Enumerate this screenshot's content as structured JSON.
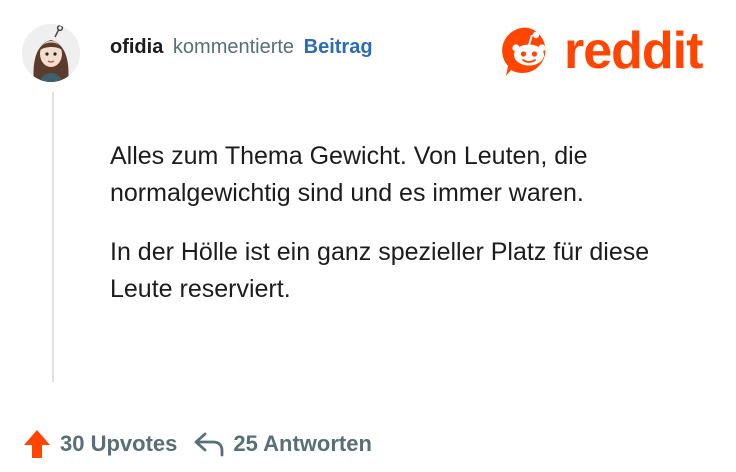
{
  "comment": {
    "username": "ofidia",
    "action": "kommentierte",
    "post_link": "Beitrag",
    "paragraphs": [
      "Alles zum Thema Gewicht. Von Leuten, die normalgewichtig sind und es immer waren.",
      "In der Hölle ist ein ganz spezieller Platz für diese Leute reserviert."
    ]
  },
  "brand": {
    "wordmark": "reddit",
    "color": "#ff4500"
  },
  "footer": {
    "upvotes_label": "30 Upvotes",
    "replies_label": "25 Antworten",
    "upvote_color": "#ff4500"
  },
  "icons": [
    "avatar",
    "reddit-snoo-icon",
    "upvote-arrow-icon",
    "reply-arrow-icon"
  ]
}
